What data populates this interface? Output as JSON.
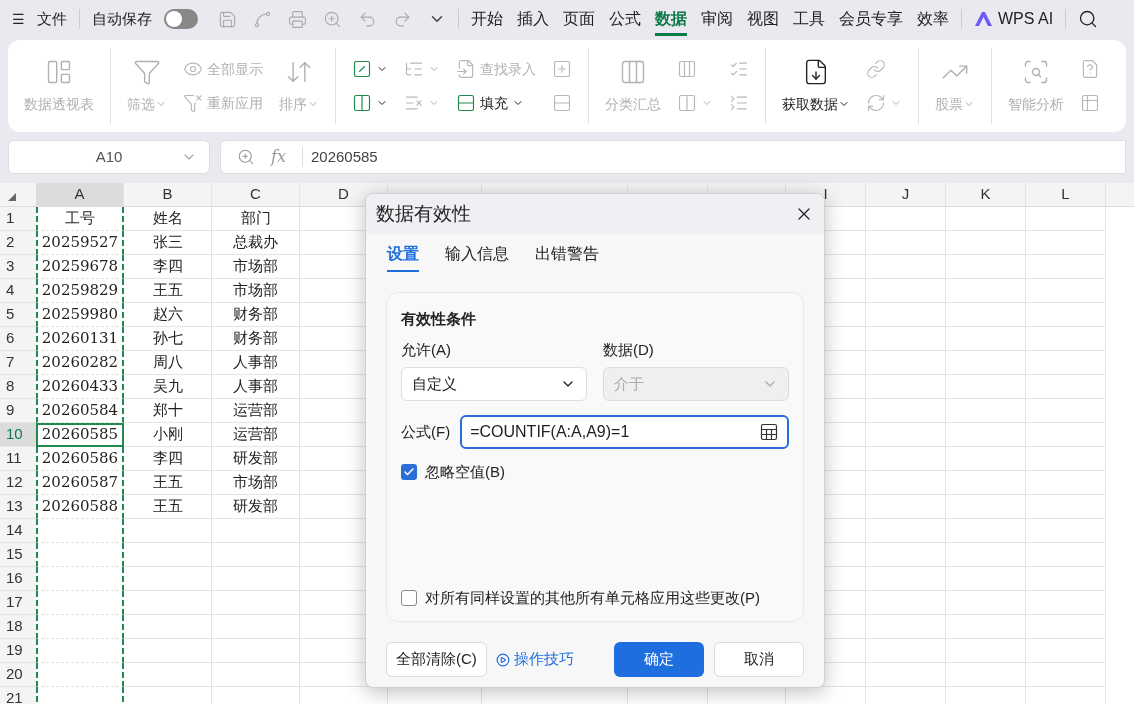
{
  "title_bar": {
    "menu_icon_label": "☰",
    "file": "文件",
    "autosave": {
      "label": "自动保存",
      "on": false
    },
    "menu_tabs": [
      {
        "label": "开始",
        "selected": false
      },
      {
        "label": "插入",
        "selected": false
      },
      {
        "label": "页面",
        "selected": false
      },
      {
        "label": "公式",
        "selected": false
      },
      {
        "label": "数据",
        "selected": true
      },
      {
        "label": "审阅",
        "selected": false
      },
      {
        "label": "视图",
        "selected": false
      },
      {
        "label": "工具",
        "selected": false
      },
      {
        "label": "会员专享",
        "selected": false
      },
      {
        "label": "效率",
        "selected": false
      }
    ],
    "ai_button": "WPS AI"
  },
  "ribbon": {
    "groups": [
      {
        "items": [
          {
            "kind": "large",
            "label": "数据透视表",
            "disabled": true,
            "dropdown": false
          }
        ]
      },
      {
        "items": [
          {
            "kind": "large",
            "label": "筛选",
            "disabled": true,
            "dropdown": true
          },
          {
            "kind": "stack",
            "items": [
              {
                "label": "全部显示",
                "disabled": true,
                "dropdown": false
              },
              {
                "label": "重新应用",
                "disabled": true,
                "dropdown": false
              }
            ]
          },
          {
            "kind": "large",
            "label": "排序",
            "disabled": true,
            "dropdown": true
          }
        ]
      },
      {
        "items": [
          {
            "kind": "stack",
            "items": [
              {
                "disabled": false,
                "dropdown": true
              },
              {
                "disabled": false,
                "dropdown": true
              }
            ]
          },
          {
            "kind": "stack",
            "items": [
              {
                "disabled": true,
                "dropdown": true
              },
              {
                "disabled": true,
                "dropdown": true
              }
            ]
          },
          {
            "kind": "stack",
            "items": [
              {
                "label": "查找录入",
                "disabled": true,
                "dropdown": false
              },
              {
                "label": "填充",
                "disabled": false,
                "dropdown": true
              }
            ]
          },
          {
            "kind": "stack",
            "items": [
              {
                "disabled": true,
                "dropdown": false
              },
              {
                "disabled": true,
                "dropdown": false
              }
            ]
          }
        ]
      },
      {
        "items": [
          {
            "kind": "large",
            "label": "分类汇总",
            "disabled": true,
            "dropdown": false
          },
          {
            "kind": "stack",
            "items": [
              {
                "disabled": true,
                "dropdown": false
              },
              {
                "disabled": true,
                "dropdown": true
              }
            ]
          },
          {
            "kind": "stack",
            "items": [
              {
                "disabled": true,
                "dropdown": false
              },
              {
                "disabled": true,
                "dropdown": false
              }
            ]
          }
        ]
      },
      {
        "items": [
          {
            "kind": "large",
            "label": "获取数据",
            "disabled": false,
            "dropdown": true
          },
          {
            "kind": "stack",
            "items": [
              {
                "disabled": true,
                "dropdown": false
              },
              {
                "disabled": true,
                "dropdown": true
              }
            ]
          }
        ]
      },
      {
        "items": [
          {
            "kind": "large",
            "label": "股票",
            "disabled": true,
            "dropdown": true
          }
        ]
      },
      {
        "items": [
          {
            "kind": "large",
            "label": "智能分析",
            "disabled": true,
            "dropdown": false
          },
          {
            "kind": "stack",
            "items": [
              {
                "disabled": true,
                "dropdown": false
              },
              {
                "disabled": true,
                "dropdown": false
              }
            ]
          }
        ]
      }
    ]
  },
  "formula_bar": {
    "name_box": "A10",
    "fx": "fx",
    "value": "20260585"
  },
  "sheet": {
    "columns": [
      {
        "label": "A",
        "selected": true,
        "marquee": true
      },
      {
        "label": "B",
        "selected": false,
        "marquee": false
      },
      {
        "label": "C",
        "selected": false,
        "marquee": false
      },
      {
        "label": "D",
        "selected": false,
        "marquee": false
      },
      {
        "selected": false,
        "marquee": false
      },
      {
        "selected": false,
        "marquee": false
      },
      {
        "selected": false,
        "marquee": false
      },
      {
        "selected": false,
        "marquee": false
      },
      {
        "label": "I",
        "selected": false,
        "marquee": false
      },
      {
        "label": "J",
        "selected": false,
        "marquee": false
      },
      {
        "label": "K",
        "selected": false,
        "marquee": false
      },
      {
        "label": "L",
        "selected": false,
        "marquee": false
      }
    ],
    "rows": [
      {
        "number": "1",
        "selected": false,
        "cells": [
          "工号",
          "姓名",
          "部门"
        ]
      },
      {
        "number": "2",
        "selected": false,
        "cells": [
          "20259527",
          "张三",
          "总裁办"
        ]
      },
      {
        "number": "3",
        "selected": false,
        "cells": [
          "20259678",
          "李四",
          "市场部"
        ]
      },
      {
        "number": "4",
        "selected": false,
        "cells": [
          "20259829",
          "王五",
          "市场部"
        ]
      },
      {
        "number": "5",
        "selected": false,
        "cells": [
          "20259980",
          "赵六",
          "财务部"
        ]
      },
      {
        "number": "6",
        "selected": false,
        "cells": [
          "20260131",
          "孙七",
          "财务部"
        ]
      },
      {
        "number": "7",
        "selected": false,
        "cells": [
          "20260282",
          "周八",
          "人事部"
        ]
      },
      {
        "number": "8",
        "selected": false,
        "cells": [
          "20260433",
          "吴九",
          "人事部"
        ]
      },
      {
        "number": "9",
        "selected": false,
        "cells": [
          "20260584",
          "郑十",
          "运营部"
        ]
      },
      {
        "number": "10",
        "selected": true,
        "cells": [
          "20260585",
          "小刚",
          "运营部"
        ]
      },
      {
        "number": "11",
        "selected": false,
        "cells": [
          "20260586",
          "李四",
          "研发部"
        ]
      },
      {
        "number": "12",
        "selected": false,
        "cells": [
          "20260587",
          "王五",
          "市场部"
        ]
      },
      {
        "number": "13",
        "selected": false,
        "cells": [
          "20260588",
          "王五",
          "研发部"
        ]
      },
      {
        "number": "14",
        "selected": false,
        "cells": []
      },
      {
        "number": "15",
        "selected": false,
        "cells": []
      },
      {
        "number": "16",
        "selected": false,
        "cells": []
      },
      {
        "number": "17",
        "selected": false,
        "cells": []
      },
      {
        "number": "18",
        "selected": false,
        "cells": []
      },
      {
        "number": "19",
        "selected": false,
        "cells": []
      },
      {
        "number": "20",
        "selected": false,
        "cells": []
      },
      {
        "number": "21",
        "selected": false,
        "cells": []
      }
    ]
  },
  "dialog": {
    "title": "数据有效性",
    "tabs": [
      {
        "label": "设置",
        "selected": true
      },
      {
        "label": "输入信息",
        "selected": false
      },
      {
        "label": "出错警告",
        "selected": false
      }
    ],
    "section_title": "有效性条件",
    "allow_label": "允许(A)",
    "allow_value": "自定义",
    "data_label": "数据(D)",
    "data_value": "介于",
    "data_disabled": true,
    "formula_label": "公式(F)",
    "formula_value": "=COUNTIF(A:A,A9)=1",
    "ignore_blank": {
      "label": "忽略空值(B)",
      "checked": true
    },
    "apply_all": {
      "label": "对所有同样设置的其他所有单元格应用这些更改(P)",
      "checked": false
    },
    "clear_button": "全部清除(C)",
    "tips_link": "操作技巧",
    "ok_button": "确定",
    "cancel_button": "取消"
  }
}
